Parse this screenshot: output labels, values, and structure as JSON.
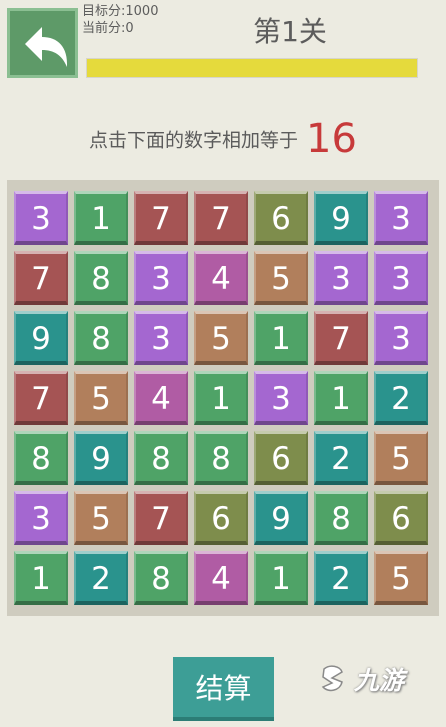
{
  "header": {
    "back_icon": "back-arrow-icon",
    "target_score_text": "目标分:1000",
    "current_score_text": "当前分:0",
    "level_title": "第1关",
    "progress": 1.0
  },
  "instruction": {
    "text": "点击下面的数字相加等于",
    "target": "16"
  },
  "colors": {
    "purple": "#a467d0",
    "green": "#4fa367",
    "red": "#a55454",
    "olive": "#7e8d4c",
    "teal": "#2a938d",
    "magenta": "#b05ca4",
    "brown": "#b17f5c",
    "background": "#ecebe1",
    "board": "#cfccbf",
    "progress": "#e5da3c",
    "target_number": "#c73a3a"
  },
  "board": {
    "rows": [
      [
        {
          "n": "3",
          "c": "purple"
        },
        {
          "n": "1",
          "c": "green"
        },
        {
          "n": "7",
          "c": "red"
        },
        {
          "n": "7",
          "c": "red"
        },
        {
          "n": "6",
          "c": "olive"
        },
        {
          "n": "9",
          "c": "teal"
        },
        {
          "n": "3",
          "c": "purple"
        }
      ],
      [
        {
          "n": "7",
          "c": "red"
        },
        {
          "n": "8",
          "c": "green"
        },
        {
          "n": "3",
          "c": "purple"
        },
        {
          "n": "4",
          "c": "magenta"
        },
        {
          "n": "5",
          "c": "brown"
        },
        {
          "n": "3",
          "c": "purple"
        },
        {
          "n": "3",
          "c": "purple"
        }
      ],
      [
        {
          "n": "9",
          "c": "teal"
        },
        {
          "n": "8",
          "c": "green"
        },
        {
          "n": "3",
          "c": "purple"
        },
        {
          "n": "5",
          "c": "brown"
        },
        {
          "n": "1",
          "c": "green"
        },
        {
          "n": "7",
          "c": "red"
        },
        {
          "n": "3",
          "c": "purple"
        }
      ],
      [
        {
          "n": "7",
          "c": "red"
        },
        {
          "n": "5",
          "c": "brown"
        },
        {
          "n": "4",
          "c": "magenta"
        },
        {
          "n": "1",
          "c": "green"
        },
        {
          "n": "3",
          "c": "purple"
        },
        {
          "n": "1",
          "c": "green"
        },
        {
          "n": "2",
          "c": "teal"
        }
      ],
      [
        {
          "n": "8",
          "c": "green"
        },
        {
          "n": "9",
          "c": "teal"
        },
        {
          "n": "8",
          "c": "green"
        },
        {
          "n": "8",
          "c": "green"
        },
        {
          "n": "6",
          "c": "olive"
        },
        {
          "n": "2",
          "c": "teal"
        },
        {
          "n": "5",
          "c": "brown"
        }
      ],
      [
        {
          "n": "3",
          "c": "purple"
        },
        {
          "n": "5",
          "c": "brown"
        },
        {
          "n": "7",
          "c": "red"
        },
        {
          "n": "6",
          "c": "olive"
        },
        {
          "n": "9",
          "c": "teal"
        },
        {
          "n": "8",
          "c": "green"
        },
        {
          "n": "6",
          "c": "olive"
        }
      ],
      [
        {
          "n": "1",
          "c": "green"
        },
        {
          "n": "2",
          "c": "teal"
        },
        {
          "n": "8",
          "c": "green"
        },
        {
          "n": "4",
          "c": "magenta"
        },
        {
          "n": "1",
          "c": "green"
        },
        {
          "n": "2",
          "c": "teal"
        },
        {
          "n": "5",
          "c": "brown"
        }
      ]
    ]
  },
  "settle_button": "结算",
  "watermark": {
    "icon": "jiuyou-logo-icon",
    "text": "九游"
  }
}
